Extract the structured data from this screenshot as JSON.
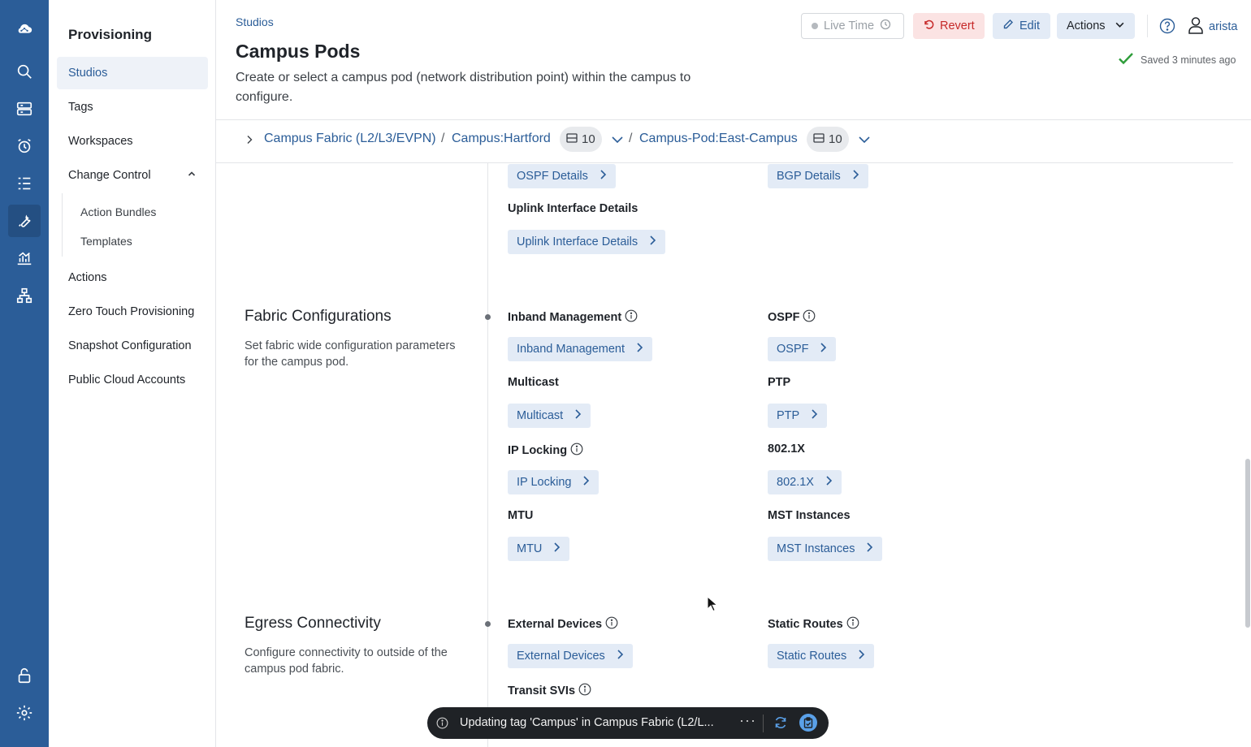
{
  "rail": {
    "icons": [
      "cloud-logo-icon",
      "search-icon",
      "inventory-icon",
      "events-alarm-icon",
      "tasks-list-icon",
      "provisioning-wrench-icon",
      "dashboards-chart-icon",
      "topology-icon",
      "lock-icon",
      "settings-gear-icon"
    ]
  },
  "sidenav": {
    "title": "Provisioning",
    "items": {
      "studios": "Studios",
      "tags": "Tags",
      "workspaces": "Workspaces",
      "change_control": "Change Control",
      "action_bundles": "Action Bundles",
      "templates": "Templates",
      "actions": "Actions",
      "ztp": "Zero Touch Provisioning",
      "snapshot": "Snapshot Configuration",
      "public_cloud": "Public Cloud Accounts"
    }
  },
  "header": {
    "breadcrumb": "Studios",
    "title": "Campus Pods",
    "description": "Create or select a campus pod (network distribution point) within the campus to configure.",
    "live_time": "Live Time",
    "revert": "Revert",
    "edit": "Edit",
    "actions": "Actions",
    "user": "arista",
    "saved": "Saved 3 minutes ago"
  },
  "crumbs": {
    "fabric": "Campus Fabric (L2/L3/EVPN)",
    "sep": "/",
    "campus": "Campus:Hartford",
    "campus_count": "10",
    "pod": "Campus-Pod:East-Campus",
    "pod_count": "10"
  },
  "routing": {
    "ospf_details": "OSPF Details",
    "bgp_details": "BGP Details",
    "uplink_label": "Uplink Interface Details",
    "uplink_btn": "Uplink Interface Details"
  },
  "fabric": {
    "title": "Fabric Configurations",
    "desc": "Set fabric wide configuration parameters for the campus pod.",
    "inband_label": "Inband Management",
    "inband_btn": "Inband Management",
    "ospf_label": "OSPF",
    "ospf_btn": "OSPF",
    "multicast_label": "Multicast",
    "multicast_btn": "Multicast",
    "ptp_label": "PTP",
    "ptp_btn": "PTP",
    "iplock_label": "IP Locking",
    "iplock_btn": "IP Locking",
    "dot1x_label": "802.1X",
    "dot1x_btn": "802.1X",
    "mtu_label": "MTU",
    "mtu_btn": "MTU",
    "mst_label": "MST Instances",
    "mst_btn": "MST Instances"
  },
  "egress": {
    "title": "Egress Connectivity",
    "desc": "Configure connectivity to outside of the campus pod fabric.",
    "ext_label": "External Devices",
    "ext_btn": "External Devices",
    "static_label": "Static Routes",
    "static_btn": "Static Routes",
    "transit_label": "Transit SVIs"
  },
  "toast": {
    "text": "Updating tag 'Campus' in Campus Fabric (L2/L...",
    "more": "···"
  },
  "colors": {
    "rail": "#2b5d98",
    "accent": "#2b5d98",
    "chip_bg": "#e3ebf6",
    "revert_bg": "#fbe3e3",
    "revert_fg": "#c62828",
    "saved_check": "#2e9d3a"
  }
}
